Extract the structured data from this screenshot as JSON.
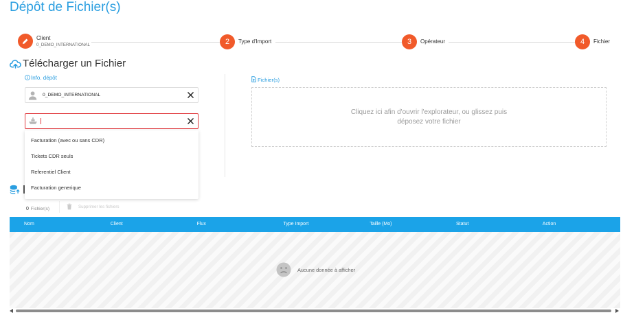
{
  "page": {
    "title": "Dépôt de Fichier(s)"
  },
  "stepper": {
    "steps": [
      {
        "icon": "pencil-icon",
        "label": "Client",
        "sublabel": "0_DEMO_INTERNATIONAL"
      },
      {
        "number": "2",
        "label": "Type d'Import"
      },
      {
        "number": "3",
        "label": "Opérateur"
      },
      {
        "number": "4",
        "label": "Fichier"
      }
    ]
  },
  "upload": {
    "icon": "cloud-upload-icon",
    "title": "Télécharger un Fichier",
    "info_link": {
      "icon": "info-circle-icon",
      "label": "Info. dépôt"
    },
    "client_select": {
      "icon": "user-icon",
      "value": "0_DEMO_INTERNATIONAL",
      "clear_icon": "close-icon"
    },
    "import_type_select": {
      "icon": "ship-icon",
      "value": "",
      "clear_icon": "close-icon"
    },
    "import_type_options": [
      "Facturation (avec ou sans CDR)",
      "Tickets CDR seuls",
      "Referentiel Client",
      "Facturation generique"
    ],
    "files_link": {
      "icon": "file-upload-icon",
      "label": "Fichier(s)"
    },
    "dropzone_text": "Cliquez ici afin d'ouvrir l'explorateur, ou glissez puis déposez votre fichier"
  },
  "files": {
    "icon": "database-upload-icon",
    "count": "0",
    "count_label": "Fichier(s)",
    "delete_button": {
      "icon": "trash-icon",
      "label": "Supprimer les fichiers"
    }
  },
  "table": {
    "columns": [
      "Nom",
      "Client",
      "Flux",
      "Type Import",
      "Taille (Mo)",
      "Statut",
      "Action"
    ],
    "empty": {
      "icon": "sad-face-icon",
      "text": "Aucune donnée à afficher"
    }
  },
  "scrollbar": {
    "left_icon": "arrow-left-icon",
    "right_icon": "arrow-right-icon"
  },
  "colors": {
    "title_blue": "#2a9ee0",
    "step_orange": "#f15a2a",
    "table_header": "#1ba3e8",
    "error_border": "#e0393e"
  }
}
